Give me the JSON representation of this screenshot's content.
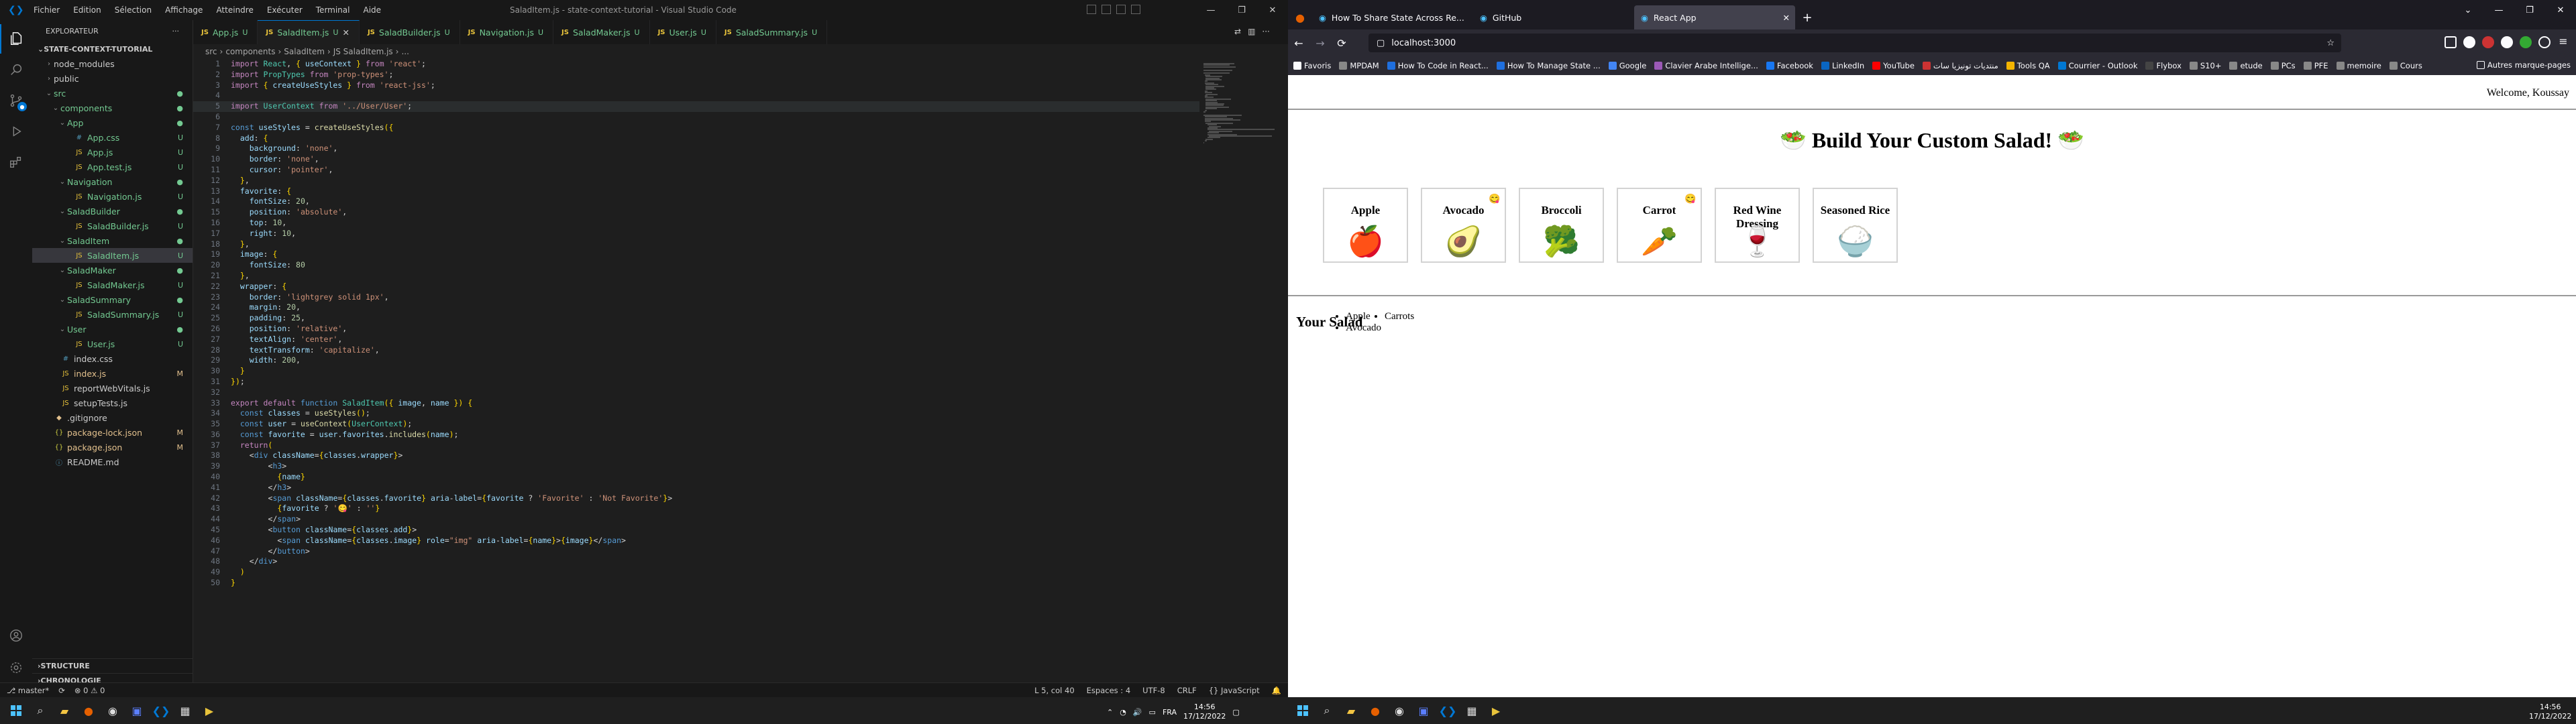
{
  "vscode": {
    "window_title": "SaladItem.js - state-context-tutorial - Visual Studio Code",
    "menu": [
      "Fichier",
      "Edition",
      "Sélection",
      "Affichage",
      "Atteindre",
      "Exécuter",
      "Terminal",
      "Aide"
    ],
    "explorer": {
      "header": "EXPLORATEUR",
      "root": "STATE-CONTEXT-TUTORIAL",
      "items": [
        {
          "label": "node_modules",
          "type": "folder",
          "depth": 1,
          "open": false,
          "status": ""
        },
        {
          "label": "public",
          "type": "folder",
          "depth": 1,
          "open": false,
          "status": ""
        },
        {
          "label": "src",
          "type": "folder",
          "depth": 1,
          "open": true,
          "status": "●"
        },
        {
          "label": "components",
          "type": "folder",
          "depth": 2,
          "open": true,
          "status": "●"
        },
        {
          "label": "App",
          "type": "folder",
          "depth": 3,
          "open": true,
          "status": "●"
        },
        {
          "label": "App.css",
          "type": "css",
          "depth": 4,
          "status": "U"
        },
        {
          "label": "App.js",
          "type": "js",
          "depth": 4,
          "status": "U"
        },
        {
          "label": "App.test.js",
          "type": "js",
          "depth": 4,
          "status": "U"
        },
        {
          "label": "Navigation",
          "type": "folder",
          "depth": 3,
          "open": true,
          "status": "●"
        },
        {
          "label": "Navigation.js",
          "type": "js",
          "depth": 4,
          "status": "U"
        },
        {
          "label": "SaladBuilder",
          "type": "folder",
          "depth": 3,
          "open": true,
          "status": "●"
        },
        {
          "label": "SaladBuilder.js",
          "type": "js",
          "depth": 4,
          "status": "U"
        },
        {
          "label": "SaladItem",
          "type": "folder",
          "depth": 3,
          "open": true,
          "status": "●"
        },
        {
          "label": "SaladItem.js",
          "type": "js",
          "depth": 4,
          "status": "U",
          "selected": true
        },
        {
          "label": "SaladMaker",
          "type": "folder",
          "depth": 3,
          "open": true,
          "status": "●"
        },
        {
          "label": "SaladMaker.js",
          "type": "js",
          "depth": 4,
          "status": "U"
        },
        {
          "label": "SaladSummary",
          "type": "folder",
          "depth": 3,
          "open": true,
          "status": "●"
        },
        {
          "label": "SaladSummary.js",
          "type": "js",
          "depth": 4,
          "status": "U"
        },
        {
          "label": "User",
          "type": "folder",
          "depth": 3,
          "open": true,
          "status": "●"
        },
        {
          "label": "User.js",
          "type": "js",
          "depth": 4,
          "status": "U"
        },
        {
          "label": "index.css",
          "type": "css",
          "depth": 2,
          "status": ""
        },
        {
          "label": "index.js",
          "type": "js",
          "depth": 2,
          "status": "M"
        },
        {
          "label": "reportWebVitals.js",
          "type": "js",
          "depth": 2,
          "status": ""
        },
        {
          "label": "setupTests.js",
          "type": "js",
          "depth": 2,
          "status": ""
        },
        {
          "label": ".gitignore",
          "type": "git",
          "depth": 1,
          "status": ""
        },
        {
          "label": "package-lock.json",
          "type": "json",
          "depth": 1,
          "status": "M"
        },
        {
          "label": "package.json",
          "type": "json",
          "depth": 1,
          "status": "M"
        },
        {
          "label": "README.md",
          "type": "md",
          "depth": 1,
          "status": ""
        }
      ],
      "sections": [
        "STRUCTURE",
        "CHRONOLOGIE"
      ]
    },
    "tabs": [
      {
        "label": "App.js",
        "mark": "U",
        "active": false
      },
      {
        "label": "SaladItem.js",
        "mark": "U",
        "active": true
      },
      {
        "label": "SaladBuilder.js",
        "mark": "U",
        "active": false
      },
      {
        "label": "Navigation.js",
        "mark": "U",
        "active": false
      },
      {
        "label": "SaladMaker.js",
        "mark": "U",
        "active": false
      },
      {
        "label": "User.js",
        "mark": "U",
        "active": false
      },
      {
        "label": "SaladSummary.js",
        "mark": "U",
        "active": false
      }
    ],
    "breadcrumb": [
      "src",
      "components",
      "SaladItem",
      "JS SaladItem.js",
      "..."
    ],
    "code": [
      "import React, { useContext } from 'react';",
      "import PropTypes from 'prop-types';",
      "import { createUseStyles } from 'react-jss';",
      "",
      "import UserContext from '../User/User';",
      "",
      "const useStyles = createUseStyles({",
      "  add: {",
      "    background: 'none',",
      "    border: 'none',",
      "    cursor: 'pointer',",
      "  },",
      "  favorite: {",
      "    fontSize: 20,",
      "    position: 'absolute',",
      "    top: 10,",
      "    right: 10,",
      "  },",
      "  image: {",
      "    fontSize: 80",
      "  },",
      "  wrapper: {",
      "    border: 'lightgrey solid 1px',",
      "    margin: 20,",
      "    padding: 25,",
      "    position: 'relative',",
      "    textAlign: 'center',",
      "    textTransform: 'capitalize',",
      "    width: 200,",
      "  }",
      "});",
      "",
      "export default function SaladItem({ image, name }) {",
      "  const classes = useStyles();",
      "  const user = useContext(UserContext);",
      "  const favorite = user.favorites.includes(name);",
      "  return(",
      "    <div className={classes.wrapper}>",
      "        <h3>",
      "          {name}",
      "        </h3>",
      "        <span className={classes.favorite} aria-label={favorite ? 'Favorite' : 'Not Favorite'}>",
      "          {favorite ? '😋' : ''}",
      "        </span>",
      "        <button className={classes.add}>",
      "          <span className={classes.image} role=\"img\" aria-label={name}>{image}</span>",
      "        </button>",
      "    </div>",
      "  )",
      "}"
    ],
    "highlighted_line": 5,
    "status": {
      "branch": "master*",
      "problems": "⊗ 0 ⚠ 0",
      "cursor": "L 5, col 40",
      "spaces": "Espaces : 4",
      "encoding": "UTF-8",
      "eol": "CRLF",
      "language": "{} JavaScript"
    }
  },
  "firefox": {
    "tabs": [
      {
        "label": "How To Share State Across Re...",
        "active": false
      },
      {
        "label": "GitHub",
        "active": false
      },
      {
        "label": "React App",
        "active": true
      }
    ],
    "url": "localhost:3000",
    "bookmarks": [
      "Favoris",
      "MPDAM",
      "How To Code in React...",
      "How To Manage State ...",
      "Google",
      "Clavier Arabe Intellige...",
      "Facebook",
      "LinkedIn",
      "YouTube",
      "منتديات تونيزيا سات",
      "Tools QA",
      "Courrier - Outlook",
      "Flybox",
      "S10+",
      "etude",
      "PCs",
      "PFE",
      "memoire",
      "Cours"
    ],
    "bookmarks_more": "Autres marque-pages"
  },
  "app": {
    "welcome": "Welcome, Koussay",
    "title": "Build Your Custom Salad!",
    "title_emoji": "🥗",
    "items": [
      {
        "name": "Apple",
        "image": "🍎",
        "favorite": false
      },
      {
        "name": "Avocado",
        "image": "🥑",
        "favorite": true
      },
      {
        "name": "Broccoli",
        "image": "🥦",
        "favorite": false
      },
      {
        "name": "Carrot",
        "image": "🥕",
        "favorite": true
      },
      {
        "name": "Red Wine Dressing",
        "image": "🍷",
        "favorite": false
      },
      {
        "name": "Seasoned Rice",
        "image": "🍚",
        "favorite": false
      }
    ],
    "favorite_emoji": "😋",
    "summary_title": "Your Salad",
    "summary_col1": [
      "Apple",
      "Avocado"
    ],
    "summary_col2": [
      "Carrots"
    ]
  },
  "taskbar": {
    "left_lang": "FRA",
    "left_time": "14:56",
    "left_date": "17/12/2022",
    "right_time": "14:56",
    "right_date": "17/12/2022"
  }
}
